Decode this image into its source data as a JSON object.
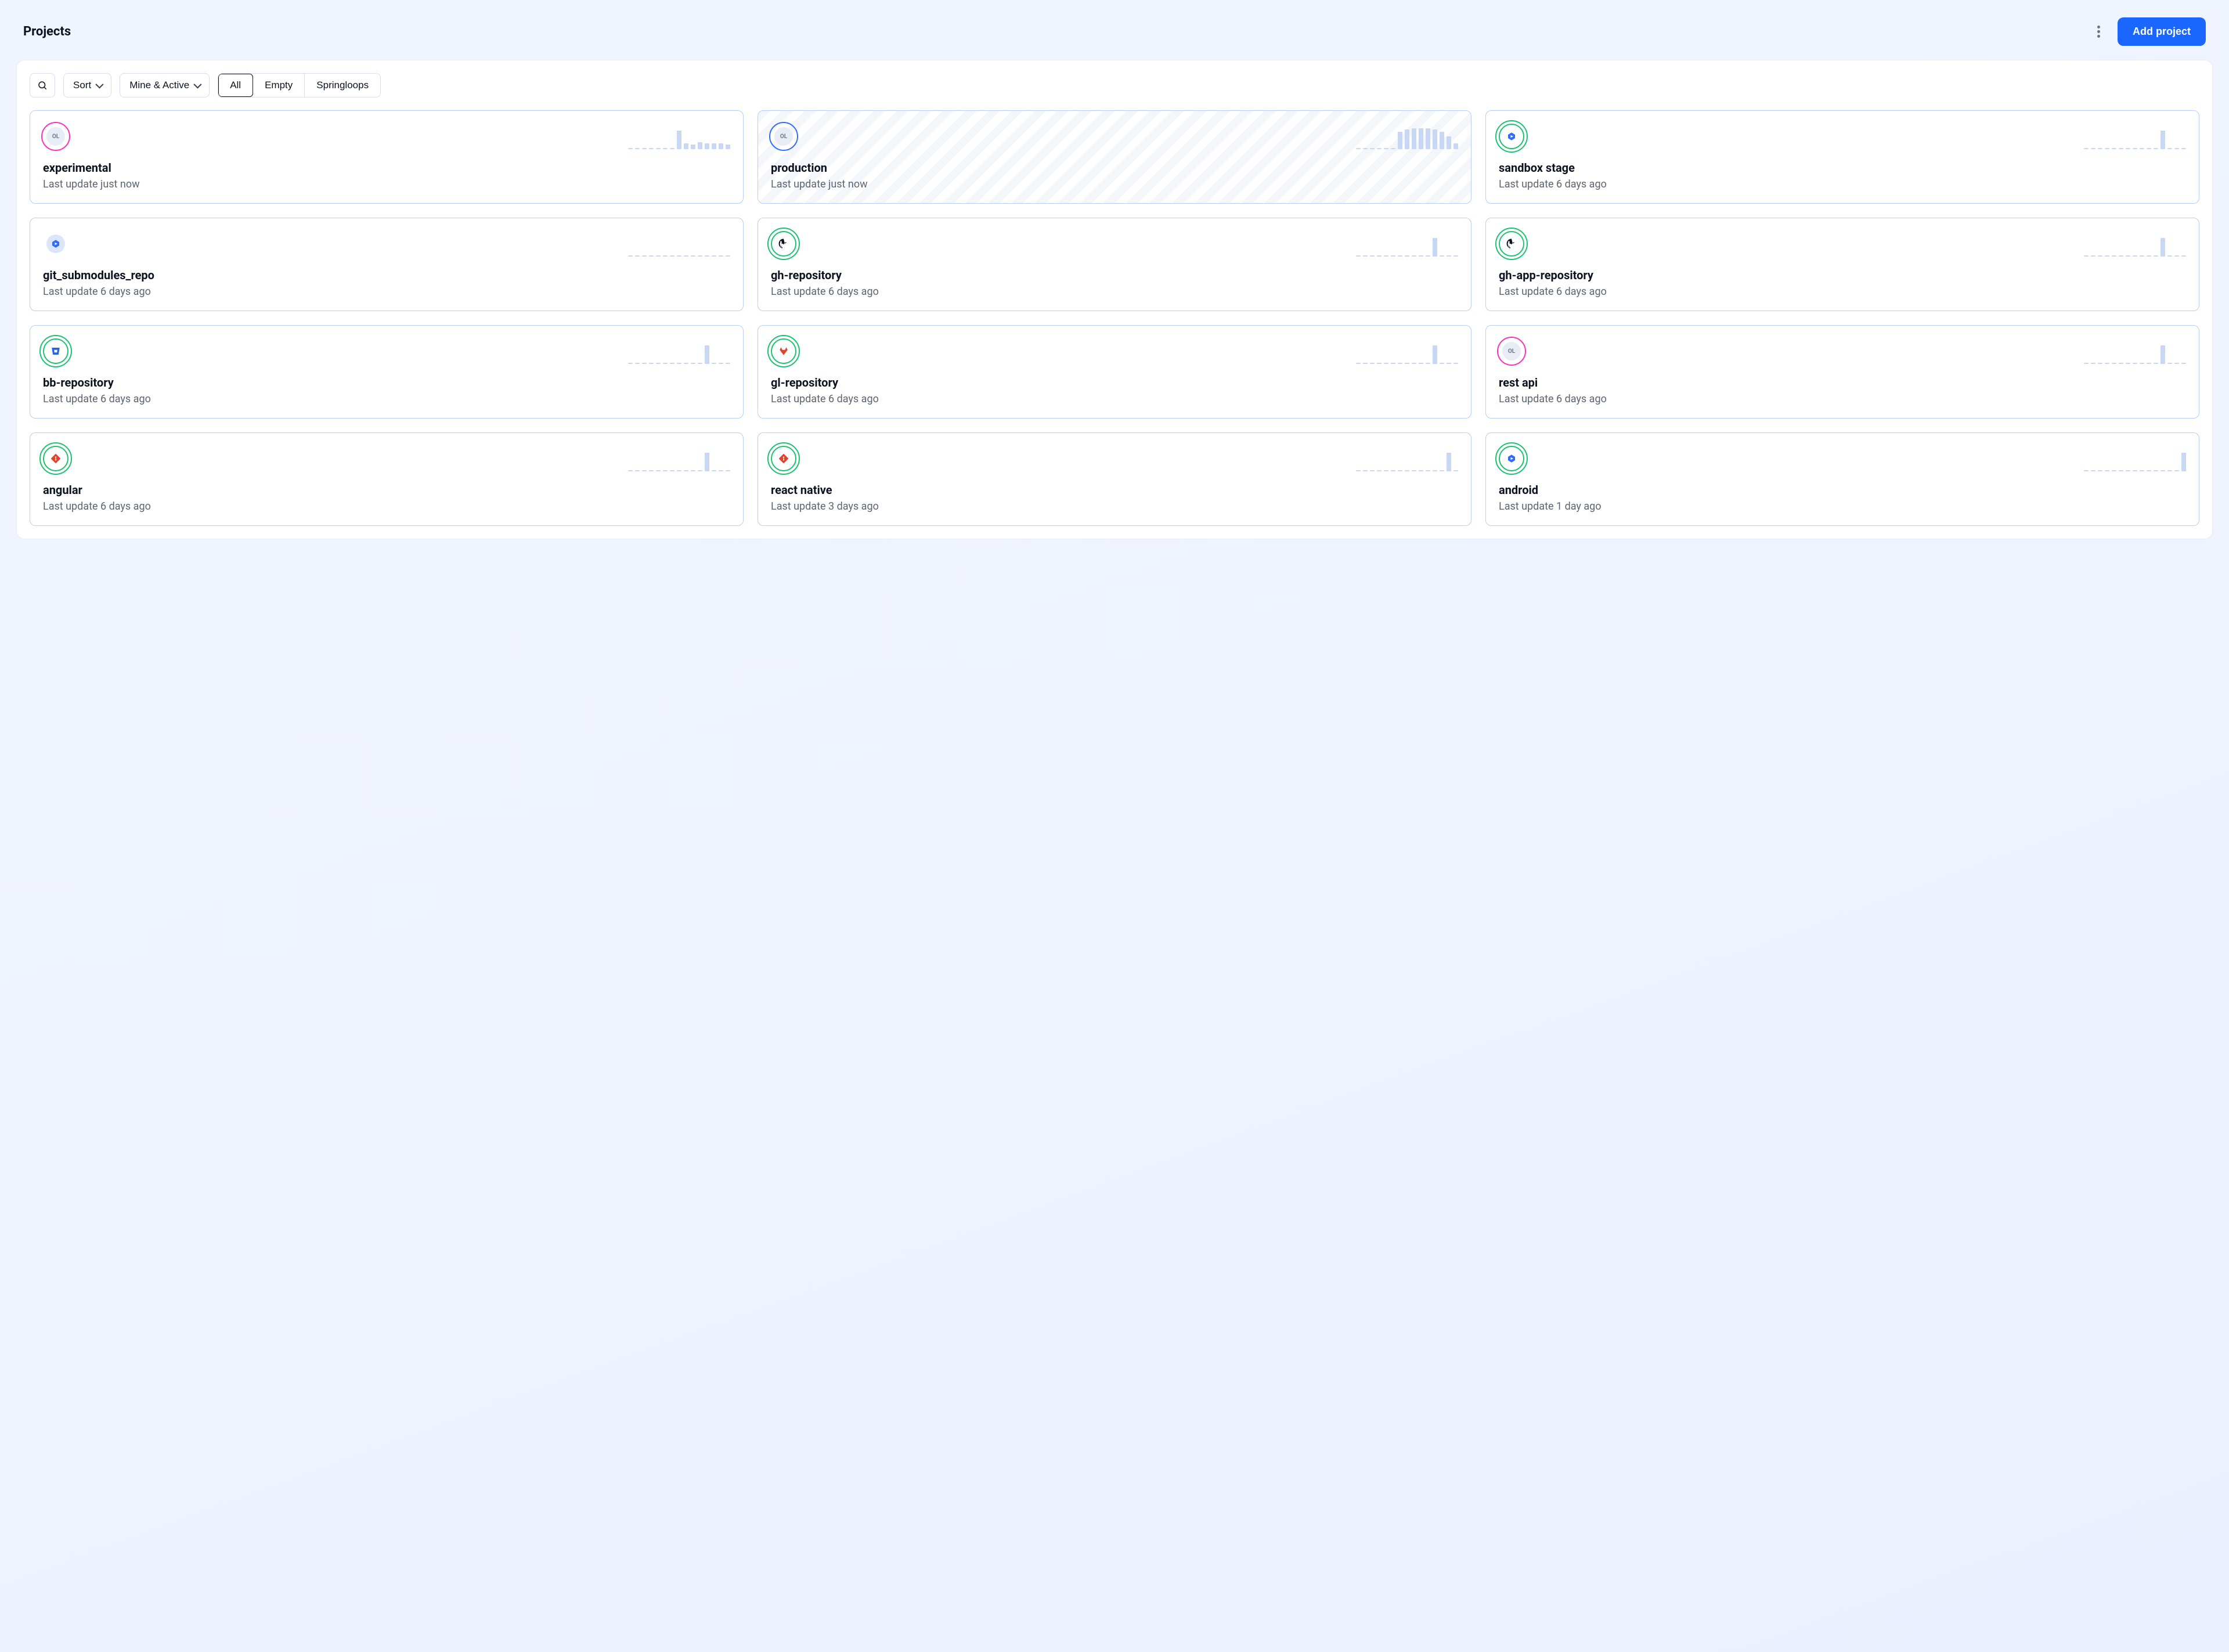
{
  "header": {
    "title": "Projects",
    "add_label": "Add project"
  },
  "toolbar": {
    "sort_label": "Sort",
    "filter_label": "Mine & Active",
    "tabs": [
      {
        "label": "All",
        "active": true
      },
      {
        "label": "Empty",
        "active": false
      },
      {
        "label": "Springloops",
        "active": false
      }
    ]
  },
  "update_prefix": "Last update",
  "projects": [
    {
      "name": "experimental",
      "updated": "just now",
      "avatar": {
        "ring": "pink",
        "inner": "gray",
        "text": "OL",
        "icon": null
      },
      "spark": [
        0,
        0,
        0,
        0,
        0,
        0,
        0,
        32,
        10,
        8,
        12,
        10,
        10,
        10,
        8
      ],
      "striped": false
    },
    {
      "name": "production",
      "updated": "just now",
      "avatar": {
        "ring": "blue",
        "inner": "gray",
        "text": "OL",
        "icon": null
      },
      "spark": [
        0,
        0,
        0,
        0,
        0,
        0,
        30,
        34,
        36,
        36,
        36,
        34,
        30,
        22,
        10
      ],
      "striped": true
    },
    {
      "name": "sandbox stage",
      "updated": "6 days ago",
      "avatar": {
        "ring": "green",
        "inner": "white",
        "text": null,
        "icon": "hex-blue"
      },
      "spark": [
        0,
        0,
        0,
        0,
        0,
        0,
        0,
        0,
        0,
        0,
        0,
        32,
        0,
        0,
        0
      ],
      "striped": false
    },
    {
      "name": "git_submodules_repo",
      "updated": "6 days ago",
      "avatar": {
        "ring": "none",
        "inner": "blue",
        "text": null,
        "icon": "hex-blue"
      },
      "spark": [
        0,
        0,
        0,
        0,
        0,
        0,
        0,
        0,
        0,
        0,
        0,
        0,
        0,
        0,
        0
      ],
      "striped": false
    },
    {
      "name": "gh-repository",
      "updated": "6 days ago",
      "avatar": {
        "ring": "green",
        "inner": "white",
        "text": null,
        "icon": "github"
      },
      "spark": [
        0,
        0,
        0,
        0,
        0,
        0,
        0,
        0,
        0,
        0,
        0,
        32,
        0,
        0,
        0
      ],
      "striped": false
    },
    {
      "name": "gh-app-repository",
      "updated": "6 days ago",
      "avatar": {
        "ring": "green",
        "inner": "white",
        "text": null,
        "icon": "github"
      },
      "spark": [
        0,
        0,
        0,
        0,
        0,
        0,
        0,
        0,
        0,
        0,
        0,
        32,
        0,
        0,
        0
      ],
      "striped": false
    },
    {
      "name": "bb-repository",
      "updated": "6 days ago",
      "avatar": {
        "ring": "green",
        "inner": "white",
        "text": null,
        "icon": "bitbucket"
      },
      "spark": [
        0,
        0,
        0,
        0,
        0,
        0,
        0,
        0,
        0,
        0,
        0,
        32,
        0,
        0,
        0
      ],
      "striped": false
    },
    {
      "name": "gl-repository",
      "updated": "6 days ago",
      "avatar": {
        "ring": "green",
        "inner": "white",
        "text": null,
        "icon": "gitlab"
      },
      "spark": [
        0,
        0,
        0,
        0,
        0,
        0,
        0,
        0,
        0,
        0,
        0,
        32,
        0,
        0,
        0
      ],
      "striped": false
    },
    {
      "name": "rest api",
      "updated": "6 days ago",
      "avatar": {
        "ring": "pink",
        "inner": "gray",
        "text": "OL",
        "icon": null
      },
      "spark": [
        0,
        0,
        0,
        0,
        0,
        0,
        0,
        0,
        0,
        0,
        0,
        32,
        0,
        0,
        0
      ],
      "striped": false
    },
    {
      "name": "angular",
      "updated": "6 days ago",
      "avatar": {
        "ring": "green",
        "inner": "white",
        "text": null,
        "icon": "git-orange"
      },
      "spark": [
        0,
        0,
        0,
        0,
        0,
        0,
        0,
        0,
        0,
        0,
        0,
        32,
        0,
        0,
        0
      ],
      "striped": false
    },
    {
      "name": "react native",
      "updated": "3 days ago",
      "avatar": {
        "ring": "green",
        "inner": "white",
        "text": null,
        "icon": "git-orange"
      },
      "spark": [
        0,
        0,
        0,
        0,
        0,
        0,
        0,
        0,
        0,
        0,
        0,
        0,
        0,
        32,
        0
      ],
      "striped": false
    },
    {
      "name": "android",
      "updated": "1 day ago",
      "avatar": {
        "ring": "green",
        "inner": "white",
        "text": null,
        "icon": "hex-blue"
      },
      "spark": [
        0,
        0,
        0,
        0,
        0,
        0,
        0,
        0,
        0,
        0,
        0,
        0,
        0,
        0,
        32
      ],
      "striped": false
    }
  ],
  "colors": {
    "primary": "#1a66ff",
    "border_card": "#b8cdf4",
    "spark": "#c8d7f3",
    "green": "#19c36e",
    "pink": "#ff2fb9"
  }
}
